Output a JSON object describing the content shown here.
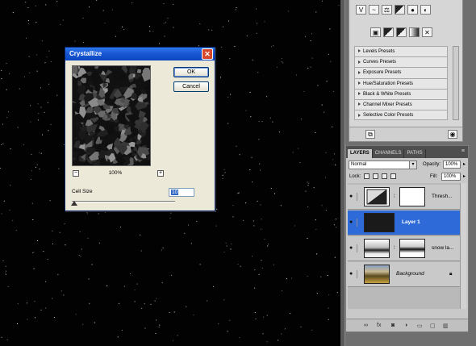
{
  "dialog": {
    "title": "Crystallize",
    "ok_label": "OK",
    "cancel_label": "Cancel",
    "zoom_out": "−",
    "zoom_in": "+",
    "zoom_value": "100%",
    "cell_size_label": "Cell Size",
    "cell_size_value": "10"
  },
  "adjustments": {
    "presets": [
      {
        "label": "Levels Presets"
      },
      {
        "label": "Curves Presets"
      },
      {
        "label": "Exposure Presets"
      },
      {
        "label": "Hue/Saturation Presets"
      },
      {
        "label": "Black & White Presets"
      },
      {
        "label": "Channel Mixer Presets"
      },
      {
        "label": "Selective Color Presets"
      }
    ],
    "icons_row1": [
      "levels-icon",
      "curves-icon",
      "balance-icon",
      "exposure-icon",
      "hue-icon",
      "color-balance-icon"
    ],
    "icons_row2": [
      "mask-icon",
      "gradient-map-icon",
      "threshold-icon",
      "posterize-icon",
      "invert-icon"
    ]
  },
  "layers_panel": {
    "tabs": [
      {
        "label": "LAYERS"
      },
      {
        "label": "CHANNELS"
      },
      {
        "label": "PATHS"
      }
    ],
    "blend_mode": "Normal",
    "opacity_label": "Opacity:",
    "opacity_value": "100%",
    "lock_label": "Lock:",
    "fill_label": "Fill:",
    "fill_value": "100%",
    "layers": [
      {
        "name": "Thresh...",
        "selected": false
      },
      {
        "name": "Layer 1",
        "selected": true
      },
      {
        "name": "snow la...",
        "selected": false
      },
      {
        "name": "Background",
        "selected": false
      }
    ]
  },
  "colors": {
    "dialog_title_bar": "#1957d3",
    "dialog_bg": "#ece9d8",
    "selected_layer": "#2e6bd8",
    "canvas_bg": "#020203",
    "panel_bg": "#c9c9c9"
  }
}
